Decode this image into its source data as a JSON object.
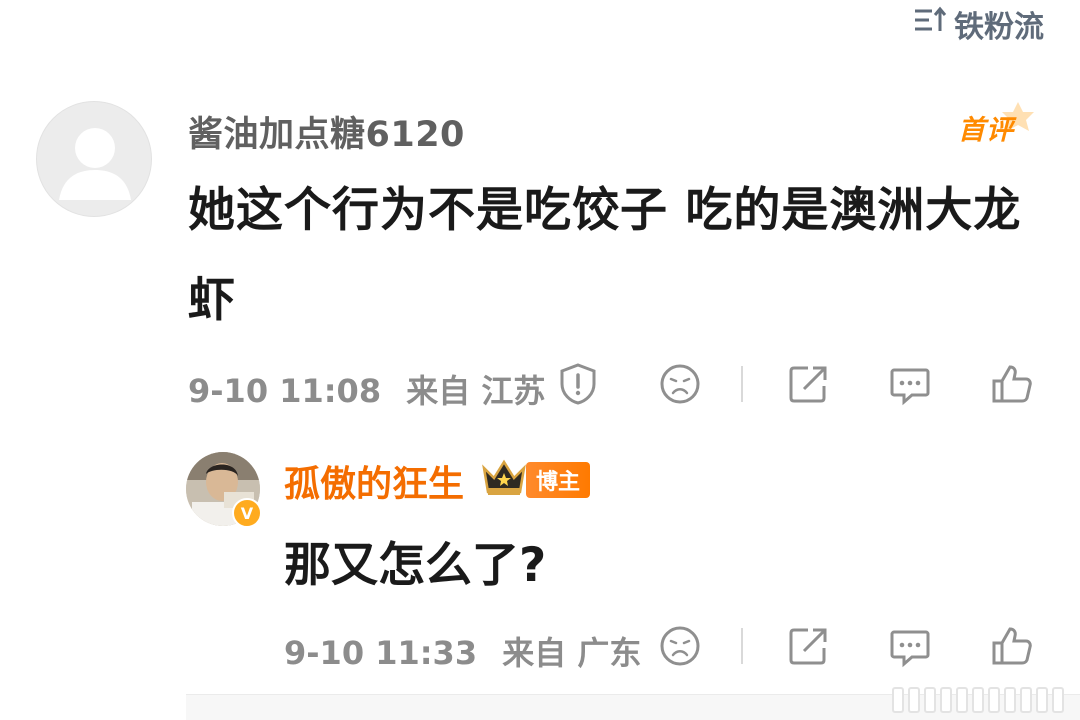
{
  "sort": {
    "icon": "sort-lines-arrow-up-icon",
    "label": "铁粉流"
  },
  "comment": {
    "avatar": "default-avatar-icon",
    "username": "酱油加点糖6120",
    "badge_label": "首评",
    "text": "她这个行为不是吃饺子 吃的是澳洲大龙虾",
    "timestamp": "9-10 11:08",
    "location": "来自 江苏",
    "actions": [
      "report-icon",
      "dislike-face-icon",
      "share-icon",
      "reply-icon",
      "like-icon"
    ]
  },
  "reply": {
    "avatar": "user-avatar",
    "verified_badge": "V",
    "username": "孤傲的狂生",
    "rank_badge_icon": "crown-icon",
    "role_label": "博主",
    "text": "那又怎么了?",
    "timestamp": "9-10 11:33",
    "location": "来自 广东",
    "actions": [
      "dislike-face-icon",
      "share-icon",
      "reply-icon",
      "like-icon"
    ]
  },
  "colors": {
    "username_gray": "#606060",
    "meta_gray": "#8c8c8c",
    "blogger_orange": "#f46d00",
    "first_comment_orange": "#ff8a00"
  }
}
